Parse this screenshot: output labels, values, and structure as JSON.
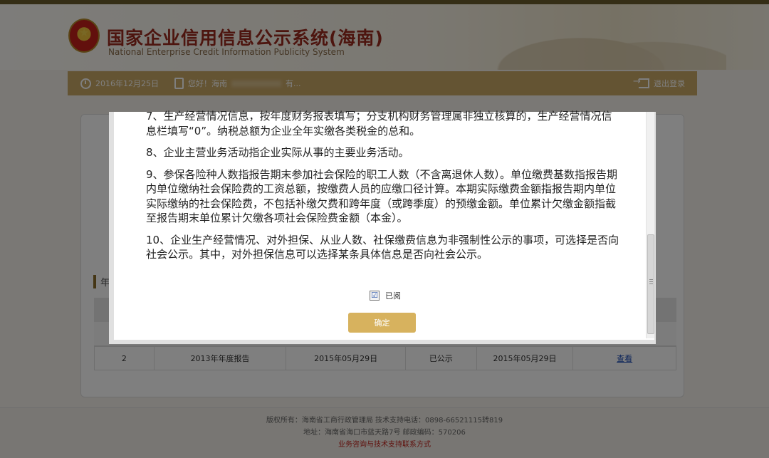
{
  "header": {
    "title_cn": "国家企业信用信息公示系统(海南)",
    "title_en": "National Enterprise Credit Information Publicity System"
  },
  "userbar": {
    "date": "2016年12月25日",
    "greeting": "您好！海南",
    "suffix": "有...",
    "logout": "退出登录"
  },
  "section": {
    "title": "年"
  },
  "table": {
    "row": {
      "index": "2",
      "report": "2013年年度报告",
      "submit_date": "2015年05月29日",
      "status": "已公示",
      "publish_date": "2015年05月29日",
      "action": "查看"
    }
  },
  "footer": {
    "line1": "版权所有：海南省工商行政管理局 技术支持电话：0898-66521115转819",
    "line2": "地址：海南省海口市蓝天路7号 邮政编码：570206",
    "line3": "业务咨询与技术支持联系方式"
  },
  "modal": {
    "paragraphs": [
      "7、生产经营情况信息，按年度财务报表填写；分支机构财务管理属非独立核算的，生产经营情况信息栏填写“0”。纳税总额为企业全年实缴各类税金的总和。",
      "8、企业主营业务活动指企业实际从事的主要业务活动。",
      "9、参保各险种人数指报告期末参加社会保险的职工人数（不含离退休人数）。单位缴费基数指报告期内单位缴纳社会保险费的工资总额，按缴费人员的应缴口径计算。本期实际缴费金额指报告期内单位实际缴纳的社会保险费，不包括补缴欠费和跨年度（或跨季度）的预缴金额。单位累计欠缴金额指截至报告期末单位累计欠缴各项社会保险费金额（本金）。",
      "10、企业生产经营情况、对外担保、从业人数、社保缴费信息为非强制性公示的事项，可选择是否向社会公示。其中，对外担保信息可以选择某条具体信息是否向社会公示。"
    ],
    "checkbox_label": "已阅",
    "checkbox_mark": "☑",
    "confirm": "确定"
  }
}
